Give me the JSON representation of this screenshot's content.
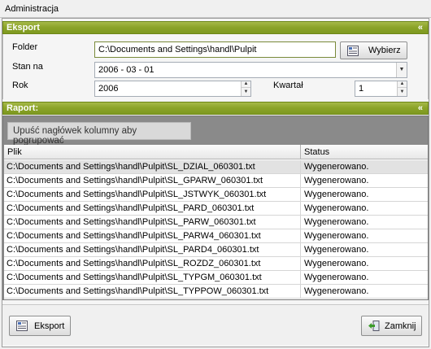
{
  "window": {
    "title": "Administracja"
  },
  "export_section": {
    "header": "Eksport",
    "collapse_glyph": "«",
    "folder_label": "Folder",
    "folder_value": "C:\\Documents and Settings\\handl\\Pulpit",
    "browse_label": "Wybierz",
    "date_label": "Stan na",
    "date_value": "2006 - 03 - 01",
    "year_label": "Rok",
    "year_value": "2006",
    "quarter_label": "Kwartał",
    "quarter_value": "1"
  },
  "report_section": {
    "header": "Raport:",
    "collapse_glyph": "«",
    "group_hint": "Upuść nagłówek kolumny aby pogrupować",
    "columns": [
      "Plik",
      "Status"
    ],
    "rows": [
      {
        "file": "C:\\Documents and Settings\\handl\\Pulpit\\SL_DZIAL_060301.txt",
        "status": "Wygenerowano."
      },
      {
        "file": "C:\\Documents and Settings\\handl\\Pulpit\\SL_GPARW_060301.txt",
        "status": "Wygenerowano."
      },
      {
        "file": "C:\\Documents and Settings\\handl\\Pulpit\\SL_JSTWYK_060301.txt",
        "status": "Wygenerowano."
      },
      {
        "file": "C:\\Documents and Settings\\handl\\Pulpit\\SL_PARD_060301.txt",
        "status": "Wygenerowano."
      },
      {
        "file": "C:\\Documents and Settings\\handl\\Pulpit\\SL_PARW_060301.txt",
        "status": "Wygenerowano."
      },
      {
        "file": "C:\\Documents and Settings\\handl\\Pulpit\\SL_PARW4_060301.txt",
        "status": "Wygenerowano."
      },
      {
        "file": "C:\\Documents and Settings\\handl\\Pulpit\\SL_PARD4_060301.txt",
        "status": "Wygenerowano."
      },
      {
        "file": "C:\\Documents and Settings\\handl\\Pulpit\\SL_ROZDZ_060301.txt",
        "status": "Wygenerowano."
      },
      {
        "file": "C:\\Documents and Settings\\handl\\Pulpit\\SL_TYPGM_060301.txt",
        "status": "Wygenerowano."
      },
      {
        "file": "C:\\Documents and Settings\\handl\\Pulpit\\SL_TYPPOW_060301.txt",
        "status": "Wygenerowano."
      }
    ]
  },
  "footer": {
    "export_label": "Eksport",
    "close_label": "Zamknij"
  },
  "colors": {
    "section_header": "#8ca42a",
    "grid_background": "#8a8a8a",
    "selected_row": "#e2e2e2"
  }
}
